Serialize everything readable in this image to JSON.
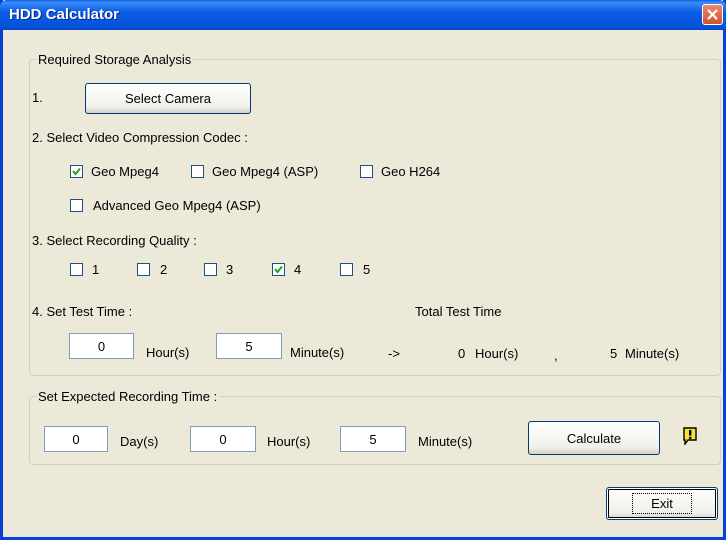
{
  "window": {
    "title": "HDD Calculator"
  },
  "analysis": {
    "legend": "Required Storage Analysis",
    "step1_num": "1.",
    "select_camera": "Select Camera",
    "step2_label": "2. Select Video Compression Codec :",
    "codecs": [
      {
        "label": "Geo Mpeg4",
        "checked": true
      },
      {
        "label": "Geo Mpeg4 (ASP)",
        "checked": false
      },
      {
        "label": "Geo H264",
        "checked": false
      },
      {
        "label": "Advanced Geo Mpeg4 (ASP)",
        "checked": false
      }
    ],
    "step3_label": "3. Select Recording Quality :",
    "quality": [
      {
        "label": "1",
        "checked": false
      },
      {
        "label": "2",
        "checked": false
      },
      {
        "label": "3",
        "checked": false
      },
      {
        "label": "4",
        "checked": true
      },
      {
        "label": "5",
        "checked": false
      }
    ],
    "step4_label": "4. Set Test Time :",
    "total_label": "Total Test Time",
    "test_hours": "0",
    "hours_unit": "Hour(s)",
    "test_minutes": "5",
    "minutes_unit": "Minute(s)",
    "arrow": "->",
    "total_hours": "0",
    "total_hours_unit": "Hour(s)",
    "separator": ",",
    "total_minutes": "5",
    "total_minutes_unit": "Minute(s)"
  },
  "expected": {
    "legend": "Set Expected Recording Time :",
    "days": "0",
    "days_unit": "Day(s)",
    "hours": "0",
    "hours_unit": "Hour(s)",
    "minutes": "5",
    "minutes_unit": "Minute(s)",
    "calculate": "Calculate",
    "warning_icon": "exclamation-icon",
    "warning_color": "#F5E33A"
  },
  "footer": {
    "exit": "Exit"
  }
}
